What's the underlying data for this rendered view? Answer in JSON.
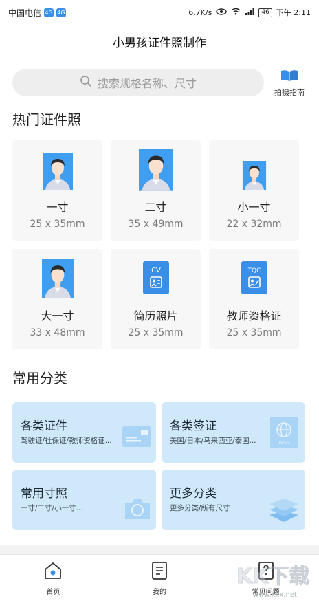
{
  "status_bar": {
    "carrier": "中国电信",
    "badge_1": "4G",
    "badge_2": "4G",
    "speed": "6.7K/s",
    "signal_label": "46",
    "time": "下午 2:11"
  },
  "title": "小男孩证件照制作",
  "search": {
    "placeholder": "搜索规格名称、尺寸",
    "guide_label": "拍摄指南"
  },
  "hot_section": {
    "title": "热门证件照",
    "items": [
      {
        "name": "一寸",
        "size": "25 x 35mm",
        "icon": "boy-portrait-icon"
      },
      {
        "name": "二寸",
        "size": "35 x 49mm",
        "icon": "boy-portrait-icon"
      },
      {
        "name": "小一寸",
        "size": "22 x 32mm",
        "icon": "boy-portrait-icon"
      },
      {
        "name": "大一寸",
        "size": "33 x 48mm",
        "icon": "boy-portrait-icon"
      },
      {
        "name": "简历照片",
        "size": "25 x 35mm",
        "icon": "cv-icon",
        "icon_text": "CV"
      },
      {
        "name": "教师资格证",
        "size": "25 x 35mm",
        "icon": "tqc-icon",
        "icon_text": "TQC"
      }
    ]
  },
  "category_section": {
    "title": "常用分类",
    "items": [
      {
        "name": "各类证件",
        "sub": "驾驶证/社保证/教师资格证...",
        "icon": "id-card-icon"
      },
      {
        "name": "各类签证",
        "sub": "美国/日本/马来西亚/泰国...",
        "icon": "passport-icon",
        "icon_text": "PASS"
      },
      {
        "name": "常用寸照",
        "sub": "一寸/二寸/小一寸...",
        "icon": "camera-icon"
      },
      {
        "name": "更多分类",
        "sub": "更多分类/所有尺寸",
        "icon": "layers-icon"
      }
    ]
  },
  "tabbar": {
    "tabs": [
      {
        "label": "首页",
        "icon": "home-icon"
      },
      {
        "label": "我的",
        "icon": "document-icon"
      },
      {
        "label": "常见问题",
        "icon": "question-icon"
      }
    ]
  },
  "watermark": {
    "text": "KK下载",
    "url": "www.kkx.net"
  },
  "colors": {
    "accent": "#3a8ee6",
    "photo_bg": "#3f9ef0",
    "category_bg": "#cfe9fb",
    "card_bg": "#f7f7f7"
  }
}
